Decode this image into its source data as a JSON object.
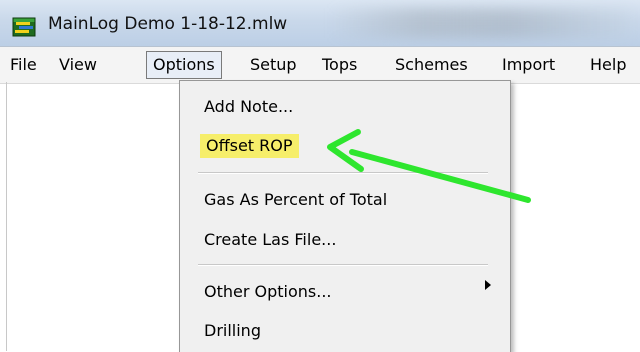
{
  "window": {
    "title": "MainLog Demo 1-18-12.mlw"
  },
  "menubar": {
    "items": [
      "File",
      "View",
      "Options",
      "Setup",
      "Tops",
      "Schemes",
      "Import",
      "Help"
    ],
    "open_menu": "Options"
  },
  "options_menu": {
    "items": [
      {
        "label": "Add Note..."
      },
      {
        "label": "Offset ROP",
        "highlighted": true
      },
      {
        "label": "Gas As Percent of Total"
      },
      {
        "label": "Create  Las File..."
      },
      {
        "label": "Other Options...",
        "has_submenu": true
      },
      {
        "label": "Drilling"
      }
    ]
  },
  "annotation": {
    "color": "#2ee62e",
    "highlight_color": "#f6ee6a"
  }
}
